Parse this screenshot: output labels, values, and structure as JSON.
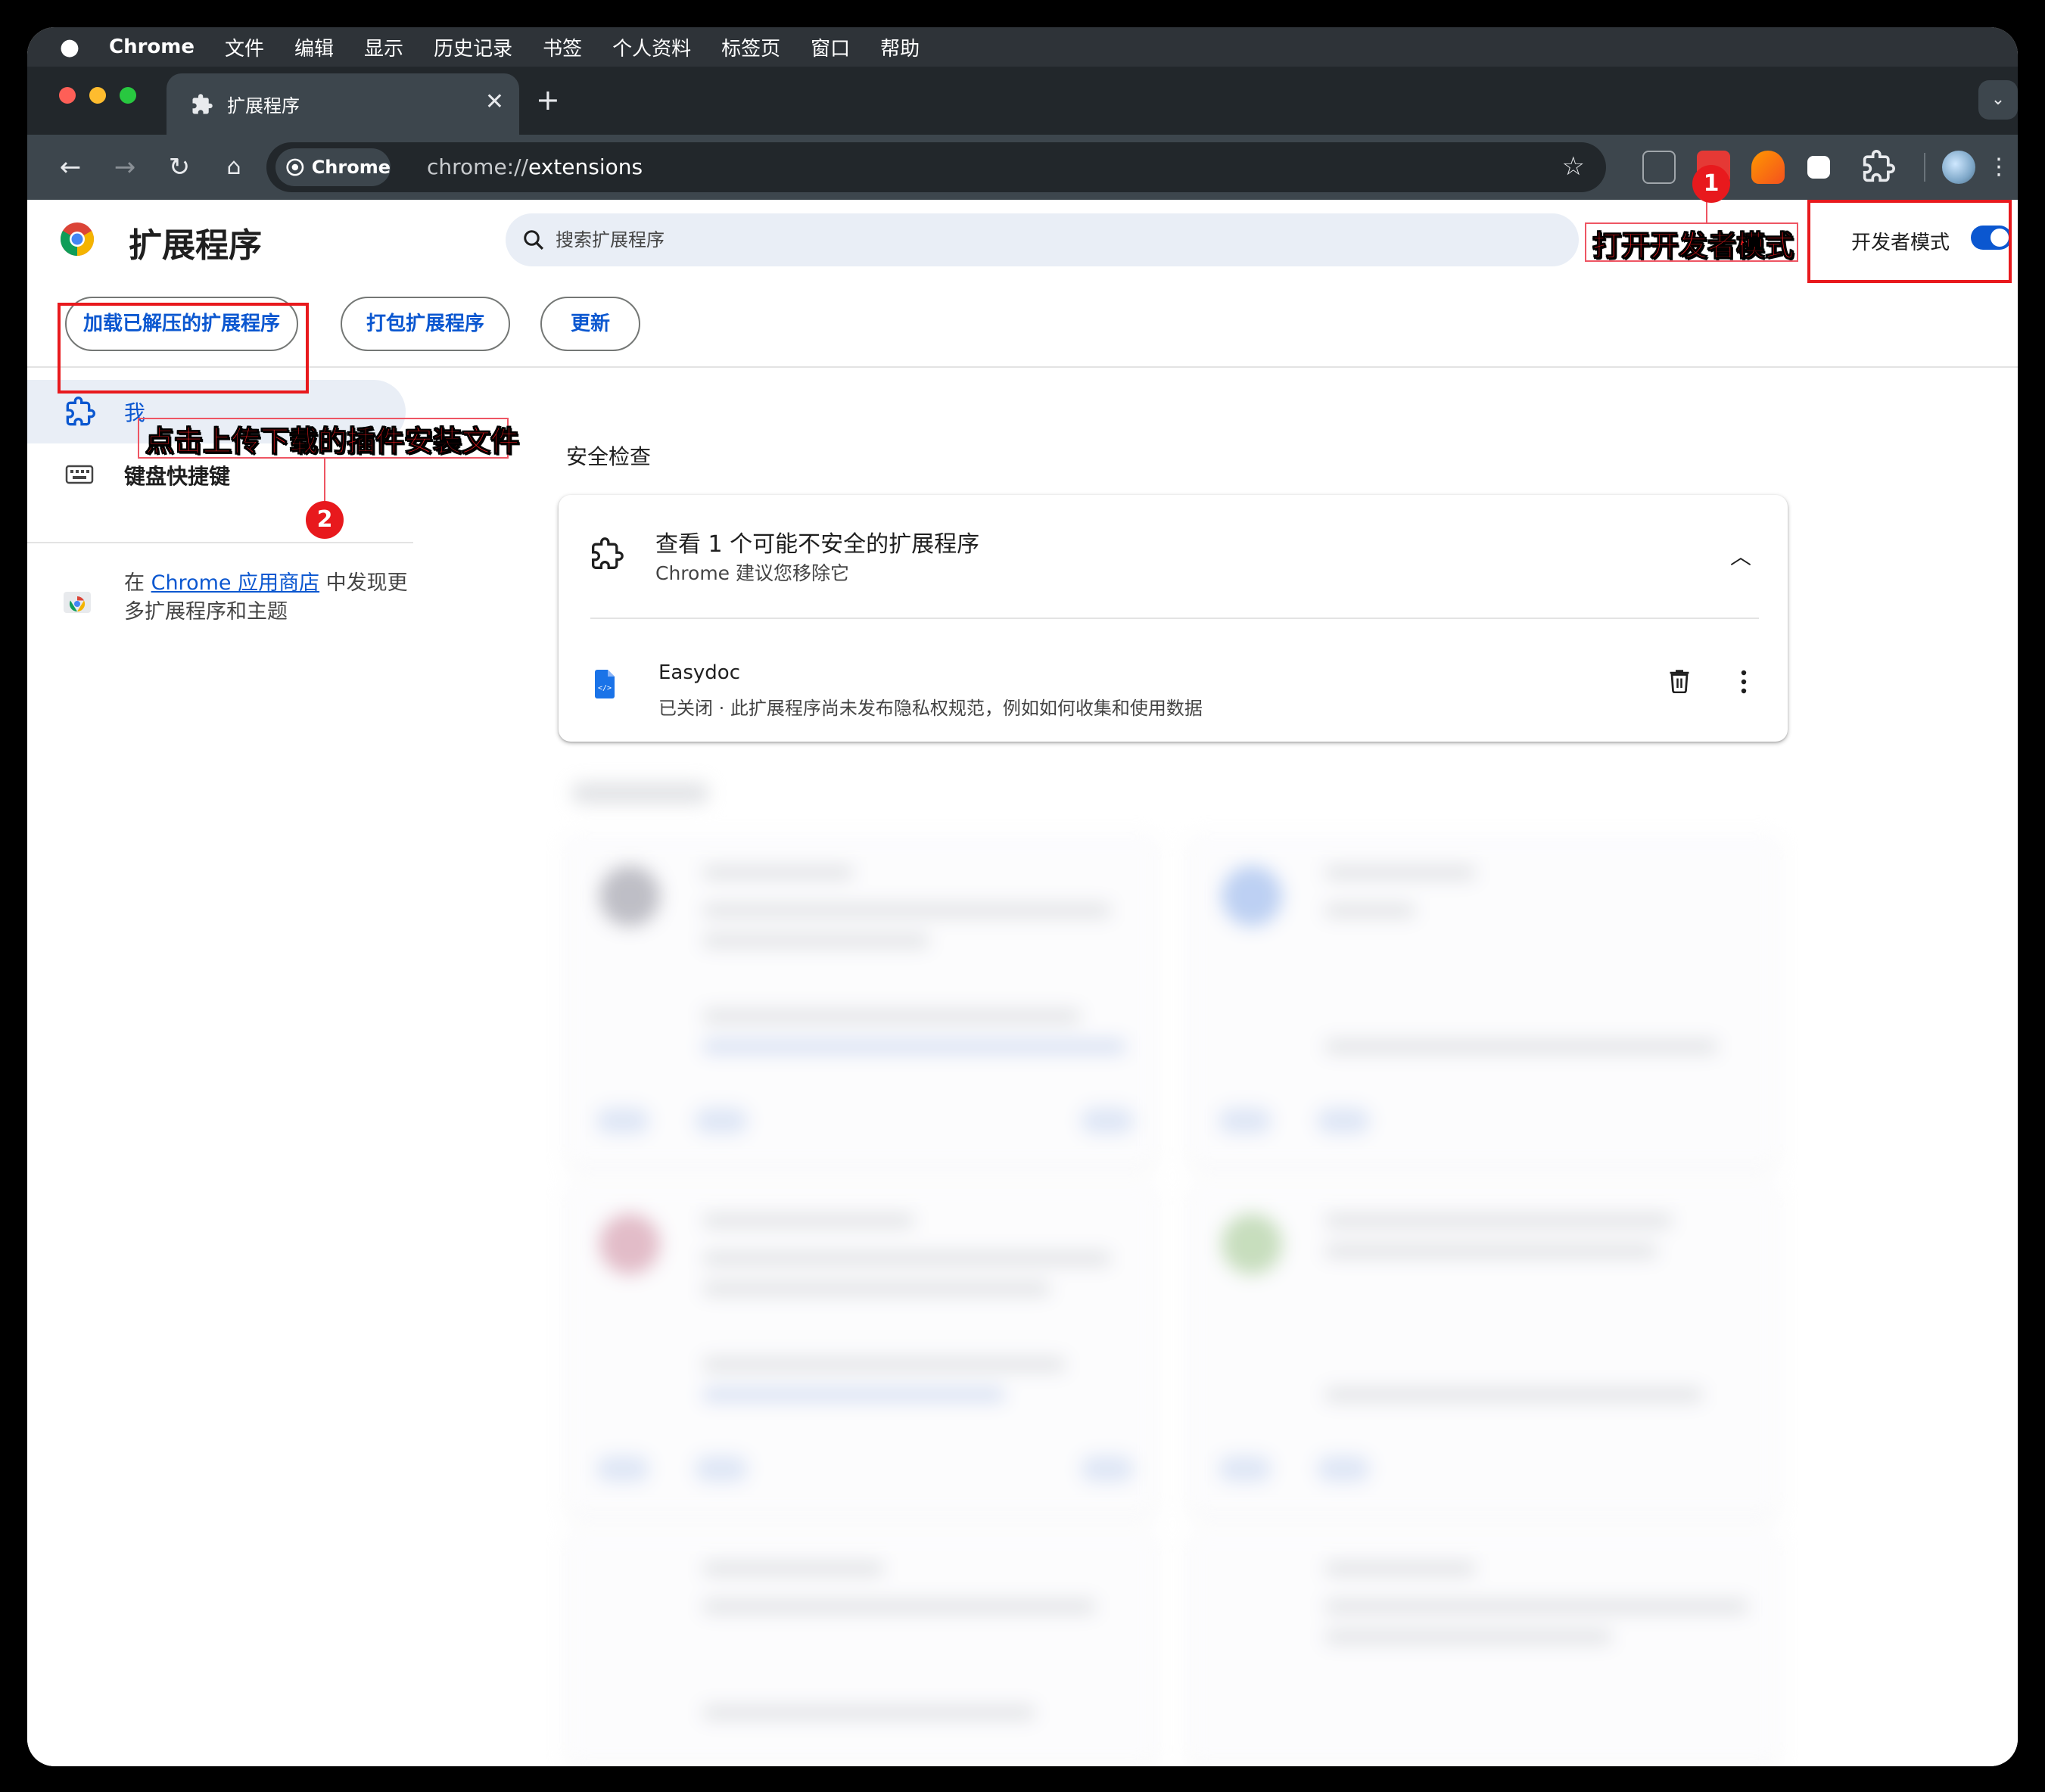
{
  "menubar": {
    "app_name": "Chrome",
    "items": [
      "文件",
      "编辑",
      "显示",
      "历史记录",
      "书签",
      "个人资料",
      "标签页",
      "窗口",
      "帮助"
    ]
  },
  "tab": {
    "title": "扩展程序",
    "close": "✕"
  },
  "toolbar": {
    "chip_label": "Chrome",
    "url_scheme": "chrome://",
    "url_host": "extensions"
  },
  "page": {
    "title": "扩展程序",
    "search_placeholder": "搜索扩展程序",
    "dev_mode_label": "开发者模式",
    "dev_mode_on": true,
    "buttons": {
      "load_unpacked": "加载已解压的扩展程序",
      "pack": "打包扩展程序",
      "update": "更新"
    }
  },
  "sidebar": {
    "my_extensions_prefix": "我",
    "keyboard_shortcuts": "键盘快捷键",
    "webstore_prefix": "在 ",
    "webstore_link": "Chrome 应用商店",
    "webstore_suffix": " 中发现更多扩展程序和主题"
  },
  "safety": {
    "heading": "安全检查",
    "title": "查看 1 个可能不安全的扩展程序",
    "subtitle": "Chrome 建议您移除它",
    "extension_name": "Easydoc",
    "extension_desc": "已关闭 · 此扩展程序尚未发布隐私权规范，例如如何收集和使用数据"
  },
  "annotations": {
    "enable_dev_mode": "打开开发者模式",
    "upload_hint": "点击上传下载的插件安装文件",
    "badge_1": "1",
    "badge_2": "2"
  },
  "colors": {
    "accent": "#0b57d0",
    "annotation_red": "#e8191d",
    "chrome_dark": "#3d464d"
  }
}
